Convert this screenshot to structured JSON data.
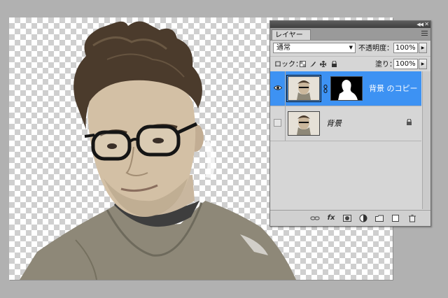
{
  "panel": {
    "tab_label": "レイヤー",
    "blend_mode": "通常",
    "opacity_label": "不透明度：",
    "opacity_value": "100%",
    "lock_label": "ロック：",
    "fill_label": "塗り：",
    "fill_value": "100%",
    "collapse_icon": "double-chevron-icon",
    "close_icon": "close-icon"
  },
  "layers": [
    {
      "name": "背景 のコピー",
      "selected": true,
      "visible": true,
      "has_mask": true
    },
    {
      "name": "背景",
      "selected": false,
      "visible": false,
      "locked": true
    }
  ],
  "footer_icons": [
    "link-icon",
    "fx-icon",
    "add-mask-icon",
    "adjustment-layer-icon",
    "new-group-icon",
    "new-layer-icon",
    "trash-icon"
  ],
  "footer_fx_label": "fx",
  "colors": {
    "selection": "#3d92f3",
    "panel_bg": "#d6d6d6",
    "workspace": "#b1b1b1"
  }
}
